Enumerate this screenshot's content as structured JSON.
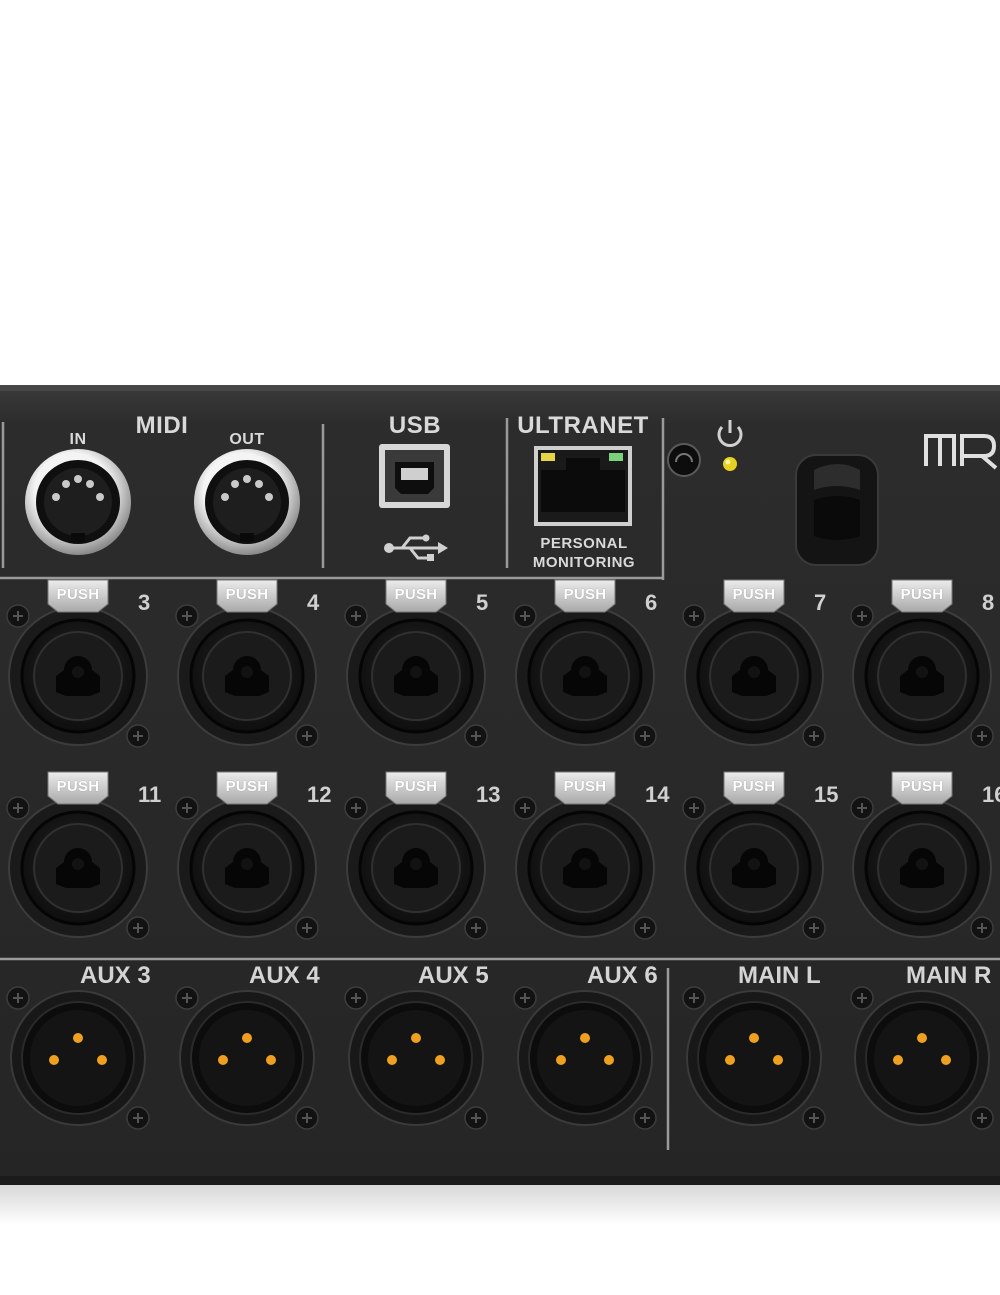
{
  "panel": {
    "midi": {
      "title": "MIDI",
      "in_label": "IN",
      "out_label": "OUT"
    },
    "usb": {
      "title": "USB"
    },
    "ultranet": {
      "title": "ULTRANET",
      "caption_line1": "PERSONAL",
      "caption_line2": "MONITORING"
    },
    "brand_partial": "MR"
  },
  "combo_jacks": {
    "push_label": "PUSH",
    "row1_numbers": [
      "3",
      "4",
      "5",
      "6",
      "7",
      "8"
    ],
    "row2_numbers": [
      "11",
      "12",
      "13",
      "14",
      "15",
      "16"
    ]
  },
  "outputs": {
    "labels": [
      "AUX 3",
      "AUX 4",
      "AUX 5",
      "AUX 6",
      "MAIN L",
      "MAIN R"
    ]
  },
  "colors": {
    "chassis": "#2b2b2b",
    "pin": "#f0a020",
    "led_yellow": "#e8d020",
    "led_green": "#7bd07b"
  }
}
